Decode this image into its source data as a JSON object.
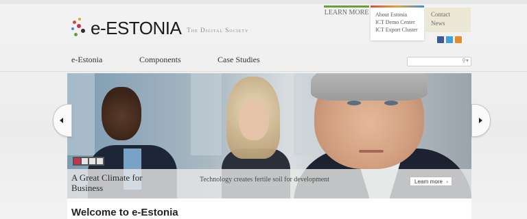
{
  "logo": {
    "text": "e-ESTONIA",
    "tagline": "The Digital Society"
  },
  "top_links": {
    "learn_more": "LEARN MORE"
  },
  "learn_more_menu": [
    "About Estonia",
    "ICT Demo Center",
    "ICT Export Cluster"
  ],
  "utility_links": [
    "Contact",
    "News"
  ],
  "social_icons": [
    "facebook-icon",
    "twitter-icon",
    "rss-icon"
  ],
  "nav": {
    "items": [
      "e-Estonia",
      "Components",
      "Case Studies"
    ]
  },
  "search": {
    "icon": "search-icon"
  },
  "hero": {
    "slides": [
      "1",
      "2",
      "3",
      "4"
    ],
    "active_slide": 0,
    "title": "A Great Climate for Business",
    "text": "Technology creates fertile soil for development",
    "button": "Learn more"
  },
  "welcome": "Welcome to e-Estonia",
  "colors": {
    "accent_red": "#c8324a",
    "learn_more_bar": "#6e9b3a",
    "facebook": "#3b5998",
    "twitter": "#3ea1da",
    "rss": "#e88a2c"
  }
}
